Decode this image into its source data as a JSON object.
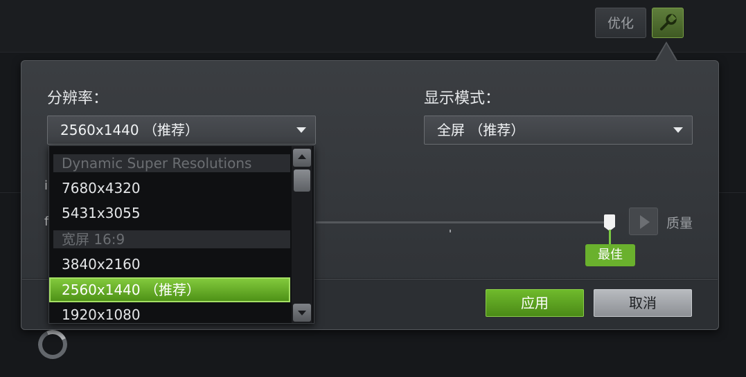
{
  "toolbar": {
    "optimize_label": "优化",
    "settings_icon": "wrench-icon"
  },
  "panel": {
    "resolution_label": "分辨率：",
    "resolution_selected": "2560x1440 （推荐）",
    "display_mode_label": "显示模式：",
    "display_mode_selected": "全屏 （推荐）",
    "quality_label": "质量",
    "slider_value_badge": "最佳",
    "apply_label": "应用",
    "cancel_label": "取消",
    "partial_chars": [
      "i",
      "f"
    ]
  },
  "resolution_options": [
    {
      "label": "Dynamic Super Resolutions",
      "type": "header"
    },
    {
      "label": "7680x4320",
      "type": "option"
    },
    {
      "label": "5431x3055",
      "type": "option"
    },
    {
      "label": "宽屏 16:9",
      "type": "header"
    },
    {
      "label": "3840x2160",
      "type": "option"
    },
    {
      "label": "2560x1440 （推荐）",
      "type": "selected"
    },
    {
      "label": "1920x1080",
      "type": "option"
    }
  ],
  "colors": {
    "accent_green": "#76b900",
    "panel_bg": "#3b3e42"
  }
}
